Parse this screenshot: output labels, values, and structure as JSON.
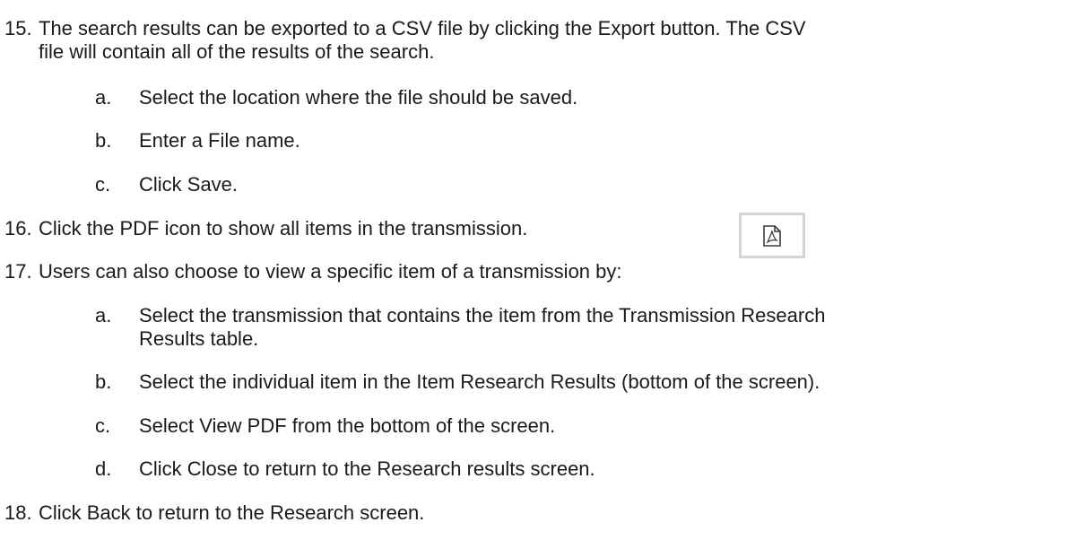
{
  "steps": [
    {
      "number": "15.",
      "lines": [
        "The search results can be exported to a CSV file by clicking the Export button. The CSV",
        "file will contain all of the results of the search."
      ],
      "substeps": [
        {
          "letter": "a.",
          "lines": [
            "Select the location where the file should be saved."
          ]
        },
        {
          "letter": "b.",
          "lines": [
            "Enter a File name."
          ]
        },
        {
          "letter": "c.",
          "lines": [
            "Click Save."
          ]
        }
      ]
    },
    {
      "number": "16.",
      "lines": [
        "Click the PDF icon to show all items in the transmission."
      ],
      "icon": "pdf-icon"
    },
    {
      "number": "17.",
      "lines": [
        "Users can also choose to view a specific item of a transmission by:"
      ],
      "substeps": [
        {
          "letter": "a.",
          "lines": [
            "Select the transmission that contains the item from the Transmission Research",
            "Results table."
          ]
        },
        {
          "letter": "b.",
          "lines": [
            "Select the individual item in the Item Research Results (bottom of the screen)."
          ]
        },
        {
          "letter": "c.",
          "lines": [
            "Select View PDF from the bottom of the screen."
          ]
        },
        {
          "letter": "d.",
          "lines": [
            "Click Close to return to the Research results screen."
          ]
        }
      ]
    },
    {
      "number": "18.",
      "lines": [
        "Click Back to return to the Research screen."
      ]
    }
  ]
}
